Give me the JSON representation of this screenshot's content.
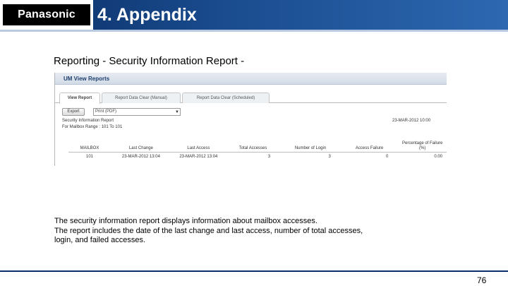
{
  "header": {
    "logo": "Panasonic",
    "title": "4. Appendix"
  },
  "slide": {
    "heading": "Reporting - Security Information Report -",
    "description_lines": [
      "The security information report displays information about mailbox accesses.",
      "The report includes the date of the last change and last access, number of total accesses,",
      "login, and failed accesses."
    ],
    "page_number": "76"
  },
  "window": {
    "title": "UM View Reports",
    "tabs": [
      {
        "label": "View Report",
        "active": true
      },
      {
        "label": "Report Data Clear (Manual)",
        "active": false
      },
      {
        "label": "Report Data Clear (Scheduled)",
        "active": false
      }
    ],
    "export_label": "Export",
    "export_format": "Print (PDF)",
    "report_title": "Security Information Report",
    "report_range": "For Mailbox Range : 101 To 101",
    "report_date": "23-MAR-2012 10:00",
    "columns": [
      "MAILBOX",
      "Last Change",
      "Last Access",
      "Total Accesses",
      "Number of Login",
      "Access Failure",
      "Percentage of Failure (%)"
    ],
    "rows": [
      [
        "101",
        "23-MAR-2012 13:04",
        "23-MAR-2012 13:04",
        "3",
        "3",
        "0",
        "0.00"
      ]
    ]
  },
  "colors": {
    "header_dark": "#0b2f66",
    "header_light": "#2d68b0"
  }
}
